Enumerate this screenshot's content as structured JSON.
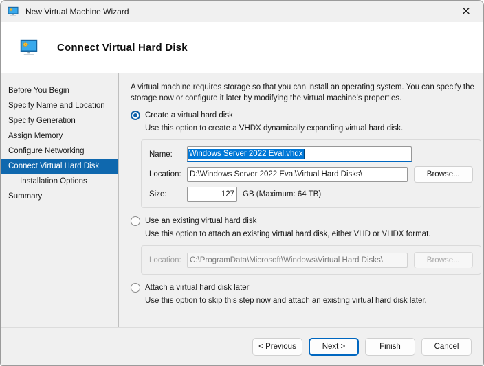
{
  "window": {
    "title": "New Virtual Machine Wizard",
    "close": "×"
  },
  "header": {
    "title": "Connect Virtual Hard Disk"
  },
  "sidebar": {
    "items": [
      {
        "label": "Before You Begin"
      },
      {
        "label": "Specify Name and Location"
      },
      {
        "label": "Specify Generation"
      },
      {
        "label": "Assign Memory"
      },
      {
        "label": "Configure Networking"
      },
      {
        "label": "Connect Virtual Hard Disk"
      },
      {
        "label": "Installation Options"
      },
      {
        "label": "Summary"
      }
    ]
  },
  "content": {
    "intro": "A virtual machine requires storage so that you can install an operating system. You can specify the storage now or configure it later by modifying the virtual machine’s properties.",
    "create": {
      "radio_label": "Create a virtual hard disk",
      "description": "Use this option to create a VHDX dynamically expanding virtual hard disk.",
      "name_label": "Name:",
      "name_value": "Windows Server 2022 Eval.vhdx",
      "location_label": "Location:",
      "location_value": "D:\\Windows Server 2022 Eval\\Virtual Hard Disks\\",
      "browse_label": "Browse...",
      "size_label": "Size:",
      "size_value": "127",
      "size_suffix": "GB (Maximum: 64 TB)"
    },
    "existing": {
      "radio_label": "Use an existing virtual hard disk",
      "description": "Use this option to attach an existing virtual hard disk, either VHD or VHDX format.",
      "location_label": "Location:",
      "location_value": "C:\\ProgramData\\Microsoft\\Windows\\Virtual Hard Disks\\",
      "browse_label": "Browse..."
    },
    "later": {
      "radio_label": "Attach a virtual hard disk later",
      "description": "Use this option to skip this step now and attach an existing virtual hard disk later."
    }
  },
  "footer": {
    "previous": "< Previous",
    "next": "Next >",
    "finish": "Finish",
    "cancel": "Cancel"
  },
  "colors": {
    "sidebar_selected": "#0f68ae",
    "selection_highlight": "#0078d7",
    "focus_accent": "#0067c0"
  }
}
